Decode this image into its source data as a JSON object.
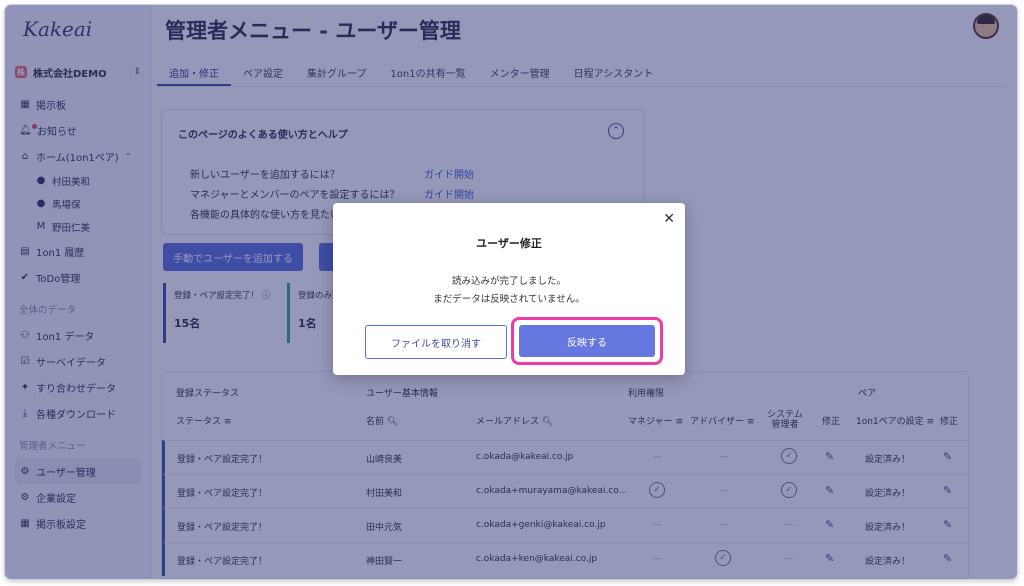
{
  "app": {
    "logo": "Kakeai"
  },
  "sidebar": {
    "company": {
      "badge": "株",
      "name": "株式会社DEMO",
      "chevron": "⌃⌄"
    },
    "items": [
      {
        "label": "掲示板"
      },
      {
        "label": "お知らせ"
      },
      {
        "label": "ホーム(1on1ペア)"
      },
      {
        "label": "村田美和"
      },
      {
        "label": "馬場保"
      },
      {
        "label": "野田仁美"
      },
      {
        "label": "1on1 履歴"
      },
      {
        "label": "ToDo管理"
      },
      {
        "label": "全体のデータ"
      },
      {
        "label": "1on1 データ"
      },
      {
        "label": "サーベイデータ"
      },
      {
        "label": "すり合わせデータ"
      },
      {
        "label": "各種ダウンロード"
      },
      {
        "label": "管理者メニュー"
      },
      {
        "label": "ユーザー管理"
      },
      {
        "label": "企業設定"
      },
      {
        "label": "掲示板設定"
      }
    ]
  },
  "header": {
    "title": "管理者メニュー - ユーザー管理"
  },
  "tabs": [
    {
      "label": "追加・修正"
    },
    {
      "label": "ペア設定"
    },
    {
      "label": "集計グループ"
    },
    {
      "label": "1on1の共有一覧"
    },
    {
      "label": "メンター管理"
    },
    {
      "label": "日程アシスタント"
    }
  ],
  "help": {
    "title": "このページのよくある使い方とヘルプ",
    "rows": [
      {
        "q": "新しいユーザーを追加するには？",
        "link": "ガイド開始"
      },
      {
        "q": "マネジャーとメンバーのペアを設定するには？",
        "link": "ガイド開始"
      },
      {
        "q": "各機能の具体的な使い方を見たい"
      }
    ]
  },
  "actions": {
    "add_manual": "手動でユーザーを追加する"
  },
  "stats": [
    {
      "label": "登録・ペア設定完了！ ⓘ",
      "value": "15名"
    },
    {
      "label": "登録のみ完",
      "value": "1名"
    }
  ],
  "table": {
    "groups": {
      "status": "登録ステータス",
      "basic": "ユーザー基本情報",
      "rights": "利用権限",
      "pair": "ペア"
    },
    "columns": {
      "status": "ステータス",
      "name": "名前",
      "email": "メールアドレス",
      "manager": "マネジャー",
      "advisor": "アドバイザー",
      "sysadmin": "システム管理者",
      "edit": "修正",
      "pair_setting": "1on1ペアの設定",
      "pair_edit": "修正"
    },
    "rows": [
      {
        "status": "登録・ペア設定完了！",
        "name": "山崎良美",
        "email": "c.okada@kakeai.co.jp",
        "manager": false,
        "advisor": false,
        "sysadmin": true,
        "pair": "設定済み！"
      },
      {
        "status": "登録・ペア設定完了！",
        "name": "村田美和",
        "email": "c.okada+murayama@kakeai.co...",
        "manager": true,
        "advisor": false,
        "sysadmin": true,
        "pair": "設定済み！"
      },
      {
        "status": "登録・ペア設定完了！",
        "name": "田中元気",
        "email": "c.okada+genki@kakeai.co.jp",
        "manager": false,
        "advisor": false,
        "sysadmin": false,
        "pair": "設定済み！"
      },
      {
        "status": "登録・ペア設定完了！",
        "name": "神田賢一",
        "email": "c.okada+ken@kakeai.co.jp",
        "manager": false,
        "advisor": true,
        "sysadmin": false,
        "pair": "設定済み！"
      }
    ]
  },
  "modal": {
    "title": "ユーザー修正",
    "message_line1": "読み込みが完了しました。",
    "message_line2": "まだデータは反映されていません。",
    "cancel_label": "ファイルを取り消す",
    "confirm_label": "反映する",
    "close": "✕"
  },
  "colors": {
    "accent": "#5b6fd8",
    "overlay": "#24286e",
    "highlight": "#ef3ba8"
  }
}
